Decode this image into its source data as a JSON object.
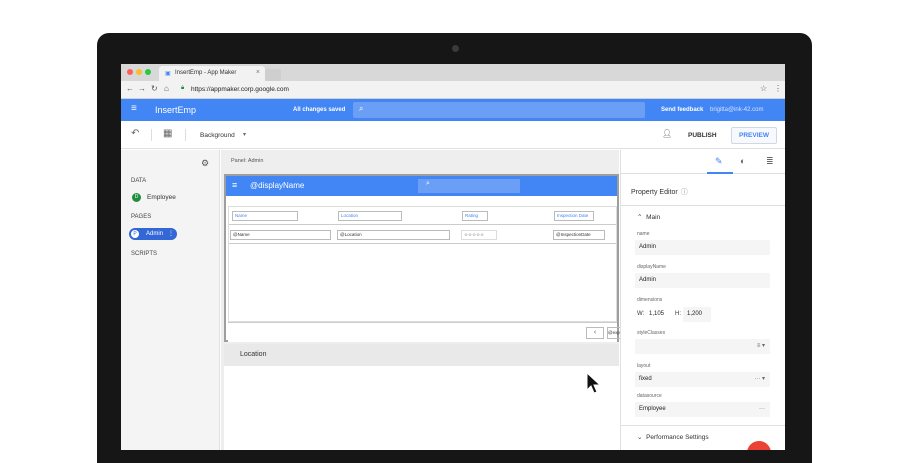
{
  "browser": {
    "tab_title": "InsertEmp - App Maker",
    "url": "https://appmaker.corp.google.com",
    "traffic_colors": [
      "#ff5f57",
      "#febc2e",
      "#28c840"
    ]
  },
  "appbar": {
    "title": "InsertEmp",
    "save_status": "All changes saved",
    "feedback": "Send feedback",
    "user": "brigitta@ink-42.com"
  },
  "toolbar": {
    "layout_select": "Background",
    "publish": "PUBLISH",
    "preview": "PREVIEW"
  },
  "leftnav": {
    "data_heading": "DATA",
    "data_item": "Employee",
    "data_badge": "D",
    "pages_heading": "PAGES",
    "page_item": "Admin",
    "page_badge": "P",
    "scripts_heading": "SCRIPTS"
  },
  "canvas": {
    "panel_label": "Panel: Admin",
    "page_title": "@displayName",
    "headers": [
      "Name",
      "Location",
      "Rating",
      "Inspection Date"
    ],
    "row": [
      "@Name",
      "@Location",
      "☆☆☆☆☆",
      "@InspectionDate"
    ],
    "pager_next": "@exp",
    "location_label": "Location"
  },
  "props": {
    "title": "Property Editor",
    "section": "Main",
    "name_label": "name",
    "name_value": "Admin",
    "displayname_label": "displayName",
    "displayname_value": "Admin",
    "dimensions_label": "dimensions",
    "dim_w_label": "W:",
    "dim_w": "1,105",
    "dim_h_label": "H:",
    "dim_h": "1,200",
    "styleclasses_label": "styleClasses",
    "layout_label": "layout",
    "layout_value": "fixed",
    "datasource_label": "datasource",
    "datasource_value": "Employee",
    "performance": "Performance Settings"
  },
  "colors": {
    "accent": "#4285f4",
    "fab": "#ea4335",
    "data_badge": "#1e8e3e"
  }
}
